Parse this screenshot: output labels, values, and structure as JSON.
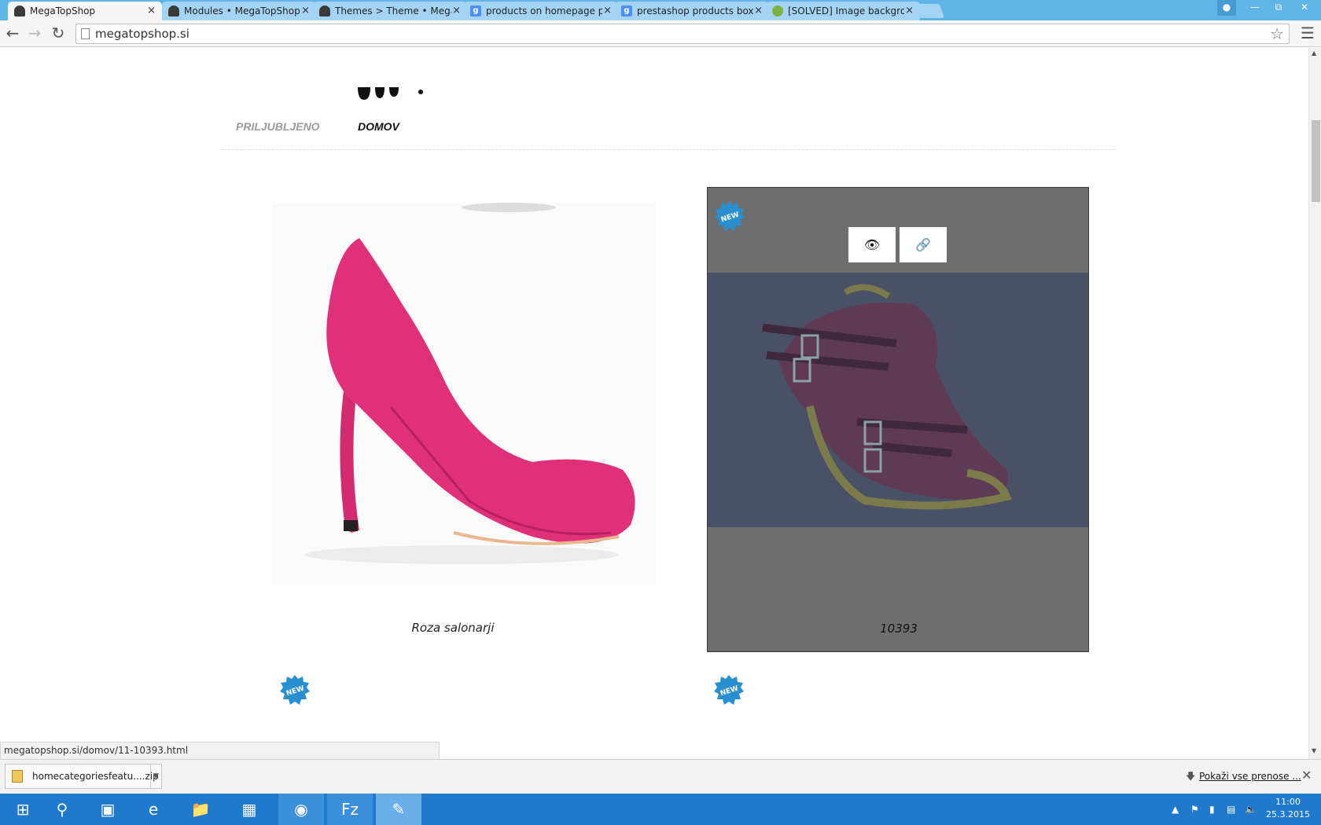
{
  "browser": {
    "tabs": [
      {
        "label": "MegaTopShop",
        "icon": "prestashop-icon"
      },
      {
        "label": "Modules • MegaTopShop",
        "icon": "prestashop-icon"
      },
      {
        "label": "Themes > Theme • MegaTopShop",
        "icon": "prestashop-icon"
      },
      {
        "label": "products on homepage pr",
        "icon": "google-icon"
      },
      {
        "label": "prestashop products box h",
        "icon": "google-icon"
      },
      {
        "label": "[SOLVED] Image backgrou",
        "icon": "forum-icon"
      }
    ],
    "close_glyph": "×",
    "url": "megatopshop.si",
    "status_url": "megatopshop.si/domov/11-10393.html"
  },
  "page": {
    "home_tabs": [
      "PRILJUBLJENO",
      "DOMOV"
    ],
    "active_tab_index": 1,
    "products": [
      {
        "name": "Roza salonarji",
        "badge": "NEW",
        "image": "pink-high-heel-shoe"
      },
      {
        "name": "10393",
        "badge": "NEW",
        "image": "purple-strap-sandal",
        "hovered": true
      }
    ],
    "next_row_badges": [
      "NEW",
      "NEW"
    ],
    "quick_actions": [
      "quick-view",
      "product-link"
    ]
  },
  "downloads": {
    "file_name": "homecategoriesfeatu....zip",
    "show_all_label": "Pokaži vse prenose ..."
  },
  "taskbar": {
    "apps": [
      "start",
      "search",
      "task-view",
      "internet-explorer",
      "file-explorer",
      "store",
      "chrome",
      "filezilla",
      "notepad"
    ],
    "time": "11:00",
    "date": "25.3.2015"
  },
  "colors": {
    "titlebar": "#5fb4e8",
    "taskbar": "#1f79cc",
    "hover_overlay": "#6e6e6e",
    "badge": "#2a8fd0"
  }
}
